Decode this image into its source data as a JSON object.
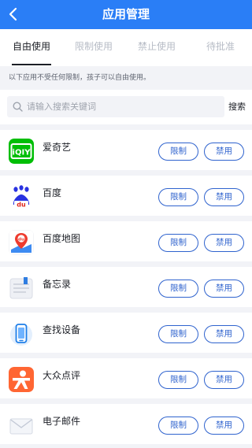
{
  "header": {
    "title": "应用管理"
  },
  "tabs": [
    {
      "label": "自由使用",
      "active": true
    },
    {
      "label": "限制使用",
      "active": false
    },
    {
      "label": "禁止使用",
      "active": false
    },
    {
      "label": "待批准",
      "active": false
    }
  ],
  "notice": "以下应用不受任何限制，孩子可以自由使用。",
  "search": {
    "placeholder": "请输入搜索关键词",
    "button": "搜索"
  },
  "apps": [
    {
      "name": "爱奇艺",
      "icon": "iqiyi-icon"
    },
    {
      "name": "百度",
      "icon": "baidu-icon"
    },
    {
      "name": "百度地图",
      "icon": "baidu-map-icon"
    },
    {
      "name": "备忘录",
      "icon": "notes-icon"
    },
    {
      "name": "查找设备",
      "icon": "find-device-icon"
    },
    {
      "name": "大众点评",
      "icon": "dianping-icon"
    },
    {
      "name": "电子邮件",
      "icon": "email-icon"
    }
  ],
  "actions": {
    "restrict": "限制",
    "ban": "禁用"
  },
  "icon_labels": {
    "iqiyi": "iQIY",
    "baidu": "du"
  },
  "colors": {
    "header": "#2a7ef6",
    "accent": "#2f63ce",
    "background": "#f2f3f7"
  }
}
